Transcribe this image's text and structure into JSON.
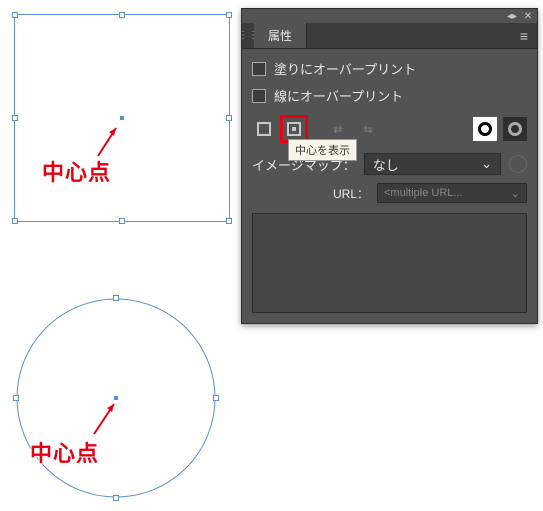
{
  "canvas": {
    "square_label": "中心点",
    "circle_label": "中心点"
  },
  "panel": {
    "tab_title": "属性",
    "overprint_fill": "塗りにオーバープリント",
    "overprint_stroke": "線にオーバープリント",
    "tooltip_show_center": "中心を表示",
    "image_map_label": "イメージマップ：",
    "image_map_value": "なし",
    "url_label": "URL：",
    "url_placeholder": "<multiple URL..."
  }
}
